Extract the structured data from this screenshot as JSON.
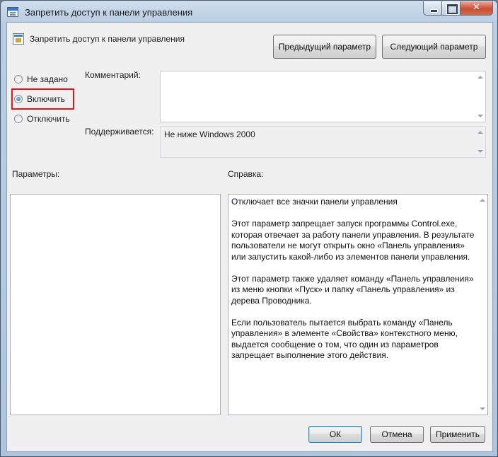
{
  "window": {
    "title": "Запретить доступ к панели управления"
  },
  "header": {
    "setting_name": "Запретить доступ к панели управления",
    "prev_button": "Предыдущий параметр",
    "next_button": "Следующий параметр"
  },
  "state": {
    "options": [
      {
        "label": "Не задано",
        "selected": false
      },
      {
        "label": "Включить",
        "selected": true
      },
      {
        "label": "Отключить",
        "selected": false
      }
    ]
  },
  "comment": {
    "label": "Комментарий:",
    "value": ""
  },
  "supported": {
    "label": "Поддерживается:",
    "value": "Не ниже Windows 2000"
  },
  "options_panel": {
    "label": "Параметры:"
  },
  "help": {
    "label": "Справка:",
    "text": "Отключает все значки панели управления\n\nЭтот параметр запрещает запуск программы Control.exe,\nкоторая отвечает за работу панели управления. В результате\nпользователи не могут открыть окно «Панель управления»\nили запустить какой-либо из элементов панели управления.\n\nЭтот параметр также удаляет команду «Панель управления»\nиз меню кнопки «Пуск» и папку «Панель управления» из\nдерева Проводника.\n\nЕсли пользователь пытается выбрать команду «Панель\nуправления» в элементе «Свойства» контекстного меню,\nвыдается сообщение о том, что один из параметров\nзапрещает выполнение этого действия."
  },
  "footer": {
    "ok": "ОК",
    "cancel": "Отмена",
    "apply": "Применить"
  },
  "colors": {
    "highlight": "#e3141c",
    "close_button": "#c94f35"
  },
  "icons": {
    "title": "group-policy-window-icon",
    "setting": "policy-setting-icon"
  }
}
